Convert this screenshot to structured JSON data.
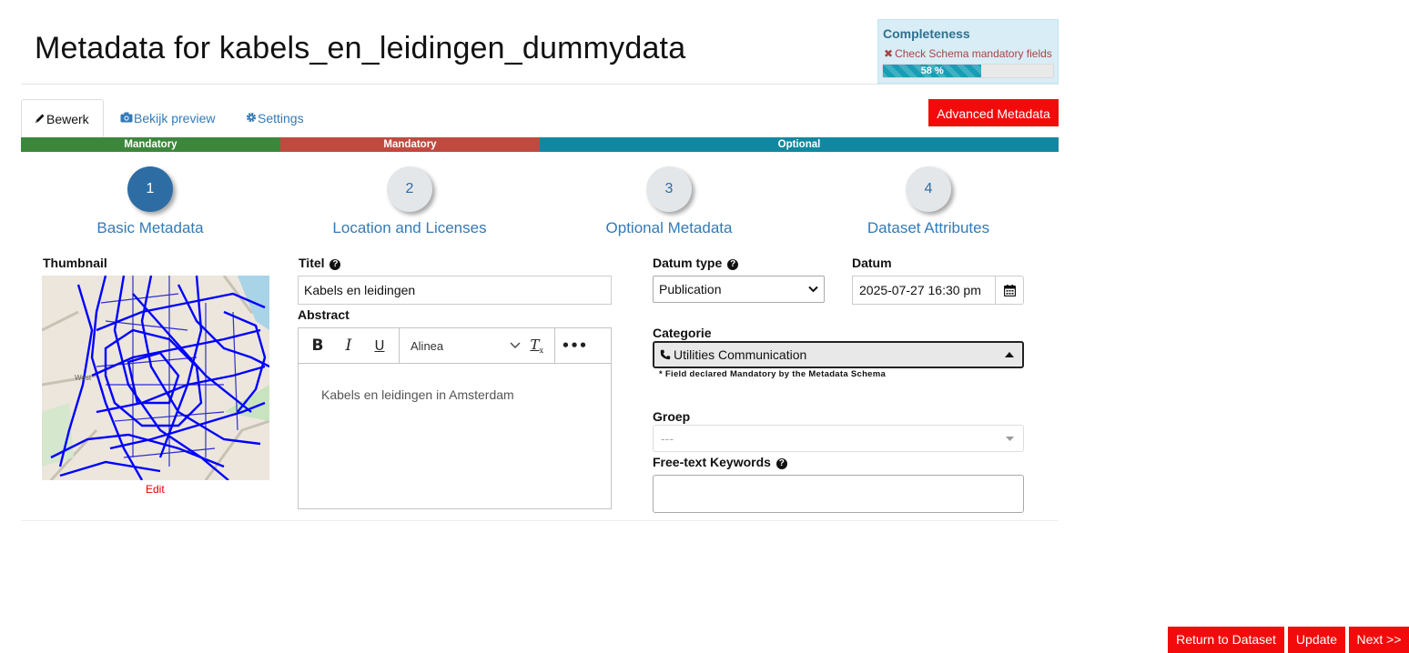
{
  "header": {
    "title": "Metadata for kabels_en_leidingen_dummydata"
  },
  "completeness": {
    "title": "Completeness",
    "check_label": "Check Schema mandatory fields",
    "percent_label": "58 %",
    "percent": 58,
    "color_fill": "#1b9cb5"
  },
  "tabs": [
    {
      "label": "Bewerk",
      "icon": "pencil-icon",
      "active": true
    },
    {
      "label": "Bekijk preview",
      "icon": "camera-icon",
      "active": false
    },
    {
      "label": "Settings",
      "icon": "gear-icon",
      "active": false
    }
  ],
  "advanced_button": "Advanced Metadata",
  "requirement_bar": [
    {
      "label": "Mandatory",
      "color": "#3c873c"
    },
    {
      "label": "Mandatory",
      "color": "#bf4a40"
    },
    {
      "label": "Optional",
      "color": "#11889f"
    }
  ],
  "steps": [
    {
      "number": "1",
      "label": "Basic Metadata",
      "active": true
    },
    {
      "number": "2",
      "label": "Location and Licenses",
      "active": false
    },
    {
      "number": "3",
      "label": "Optional Metadata",
      "active": false
    },
    {
      "number": "4",
      "label": "Dataset Attributes",
      "active": false
    }
  ],
  "form": {
    "thumbnail_label": "Thumbnail",
    "thumbnail_edit": "Edit",
    "titel_label": "Titel",
    "titel_value": "Kabels en leidingen",
    "abstract_label": "Abstract",
    "editor": {
      "paragraph_label": "Alinea",
      "content": "Kabels en leidingen in Amsterdam"
    },
    "datum_type_label": "Datum type",
    "datum_type_value": "Publication",
    "datum_label": "Datum",
    "datum_value": "2025-07-27 16:30 pm",
    "categorie_label": "Categorie",
    "categorie_value": "Utilities Communication",
    "categorie_note": "* Field declared Mandatory by the Metadata Schema",
    "groep_label": "Groep",
    "groep_placeholder": "---",
    "keywords_label": "Free-text Keywords"
  },
  "footer": {
    "return_label": "Return to Dataset",
    "update_label": "Update",
    "next_label": "Next >>"
  }
}
